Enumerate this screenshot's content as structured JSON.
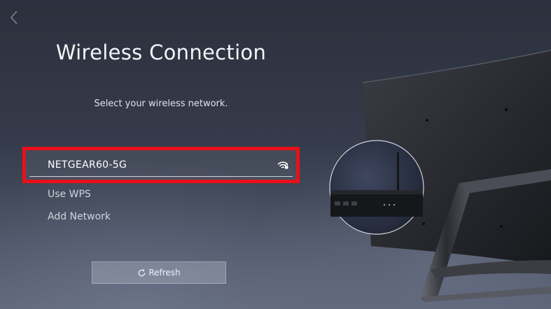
{
  "header": {
    "title": "Wireless Connection",
    "subtitle": "Select your wireless network."
  },
  "networks": {
    "selected": {
      "label": "NETGEAR60-5G",
      "signal_icon": "wifi-secured-icon"
    },
    "items": [
      {
        "label": "Use WPS"
      },
      {
        "label": "Add Network"
      }
    ]
  },
  "actions": {
    "refresh_label": "Refresh",
    "refresh_icon": "refresh-icon"
  },
  "colors": {
    "highlight_border": "#e8101a",
    "background_top": "#2b303d",
    "background_bottom": "#5a6175"
  },
  "icons": {
    "back": "chevron-left-icon",
    "illustration": "tv-router-illustration"
  }
}
